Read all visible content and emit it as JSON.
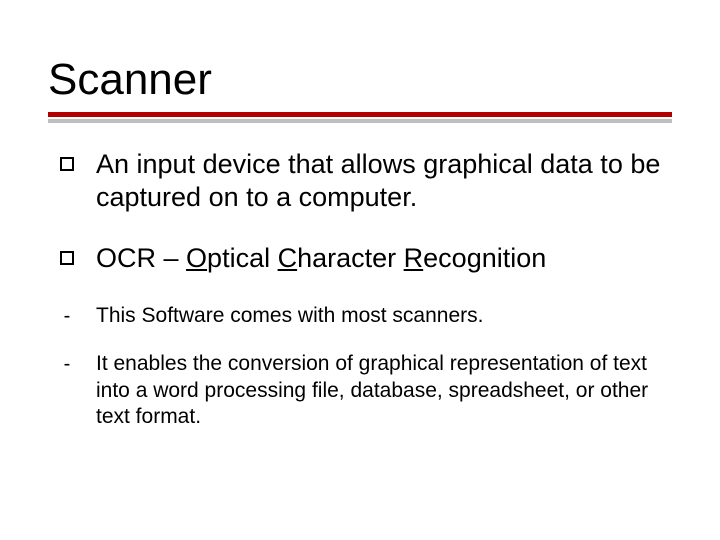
{
  "title": "Scanner",
  "bullets": {
    "main1": "An input device that allows graphical data to be captured on to a computer.",
    "main2_prefix": "OCR – ",
    "main2_O": "O",
    "main2_ptical": "ptical ",
    "main2_C": "C",
    "main2_haracter": "haracter ",
    "main2_R": "R",
    "main2_ecognition": "ecognition",
    "sub1": "This Software comes with most scanners.",
    "sub2": "It enables the conversion of graphical representation of text into a word processing file, database, spreadsheet, or other text format."
  }
}
